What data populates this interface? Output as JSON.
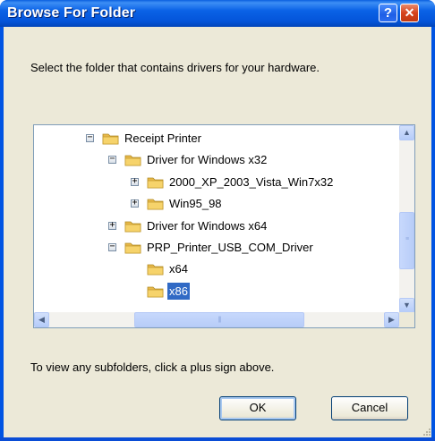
{
  "window": {
    "title": "Browse For Folder",
    "help_label": "?",
    "close_label": "✕"
  },
  "dialog": {
    "instruction": "Select the folder that contains drivers for your hardware.",
    "hint": "To view any subfolders, click a plus sign above."
  },
  "tree": {
    "items": [
      {
        "label": "Receipt Printer",
        "expander": "−",
        "depth": 0,
        "selected": false
      },
      {
        "label": "Driver for Windows x32",
        "expander": "−",
        "depth": 1,
        "selected": false
      },
      {
        "label": "2000_XP_2003_Vista_Win7x32",
        "expander": "+",
        "depth": 2,
        "selected": false
      },
      {
        "label": "Win95_98",
        "expander": "+",
        "depth": 2,
        "selected": false
      },
      {
        "label": "Driver for Windows x64",
        "expander": "+",
        "depth": 1,
        "selected": false
      },
      {
        "label": "PRP_Printer_USB_COM_Driver",
        "expander": "−",
        "depth": 1,
        "selected": false
      },
      {
        "label": "x64",
        "expander": "",
        "depth": 2,
        "selected": false
      },
      {
        "label": "x86",
        "expander": "",
        "depth": 2,
        "selected": true
      }
    ]
  },
  "buttons": {
    "ok_label": "OK",
    "cancel_label": "Cancel"
  },
  "icons": {
    "folder": "folder-icon",
    "scroll_up": "chevron-up-icon",
    "scroll_down": "chevron-down-icon",
    "scroll_left": "chevron-left-icon",
    "scroll_right": "chevron-right-icon"
  },
  "colors": {
    "selection": "#316ac5",
    "titlebar": "#0054e3",
    "folder": "#f6d36b"
  }
}
